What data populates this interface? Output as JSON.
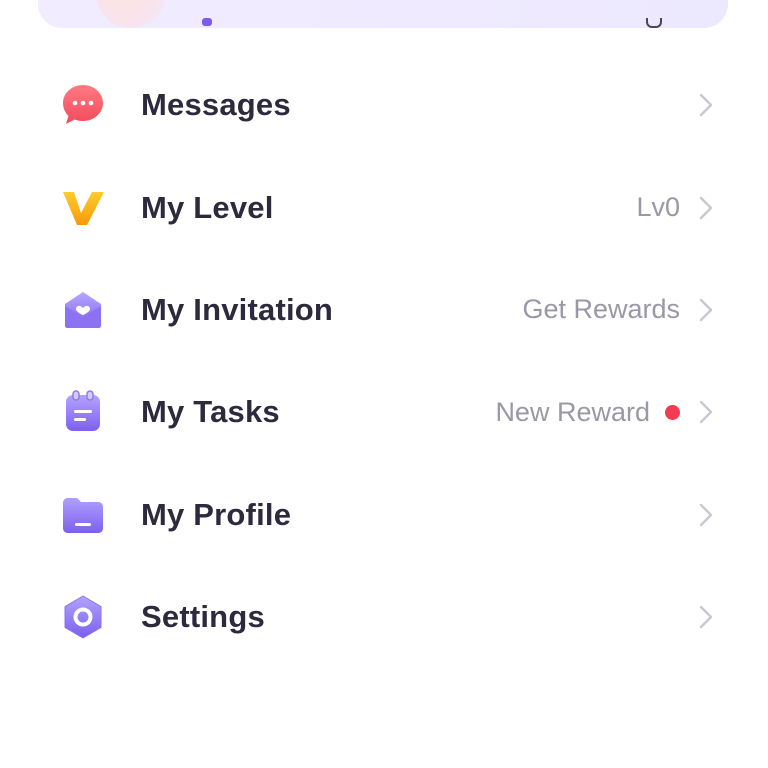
{
  "menu": {
    "items": [
      {
        "key": "messages",
        "label": "Messages",
        "right_text": "",
        "has_dot": false,
        "icon": "chat-bubble-icon"
      },
      {
        "key": "level",
        "label": "My Level",
        "right_text": "Lv0",
        "has_dot": false,
        "icon": "v-badge-icon"
      },
      {
        "key": "invitation",
        "label": "My Invitation",
        "right_text": "Get Rewards",
        "has_dot": false,
        "icon": "envelope-heart-icon"
      },
      {
        "key": "tasks",
        "label": "My Tasks",
        "right_text": "New Reward",
        "has_dot": true,
        "icon": "clipboard-icon"
      },
      {
        "key": "profile",
        "label": "My Profile",
        "right_text": "",
        "has_dot": false,
        "icon": "folder-icon"
      },
      {
        "key": "settings",
        "label": "Settings",
        "right_text": "",
        "has_dot": false,
        "icon": "hexagon-settings-icon"
      }
    ]
  },
  "colors": {
    "label_text": "#2d2a3e",
    "secondary_text": "#9a98a6",
    "chevron": "#c9c7d2",
    "notification_dot": "#f23b52",
    "accent_purple": "#8b75f0",
    "card_background": "#f0ebff"
  }
}
